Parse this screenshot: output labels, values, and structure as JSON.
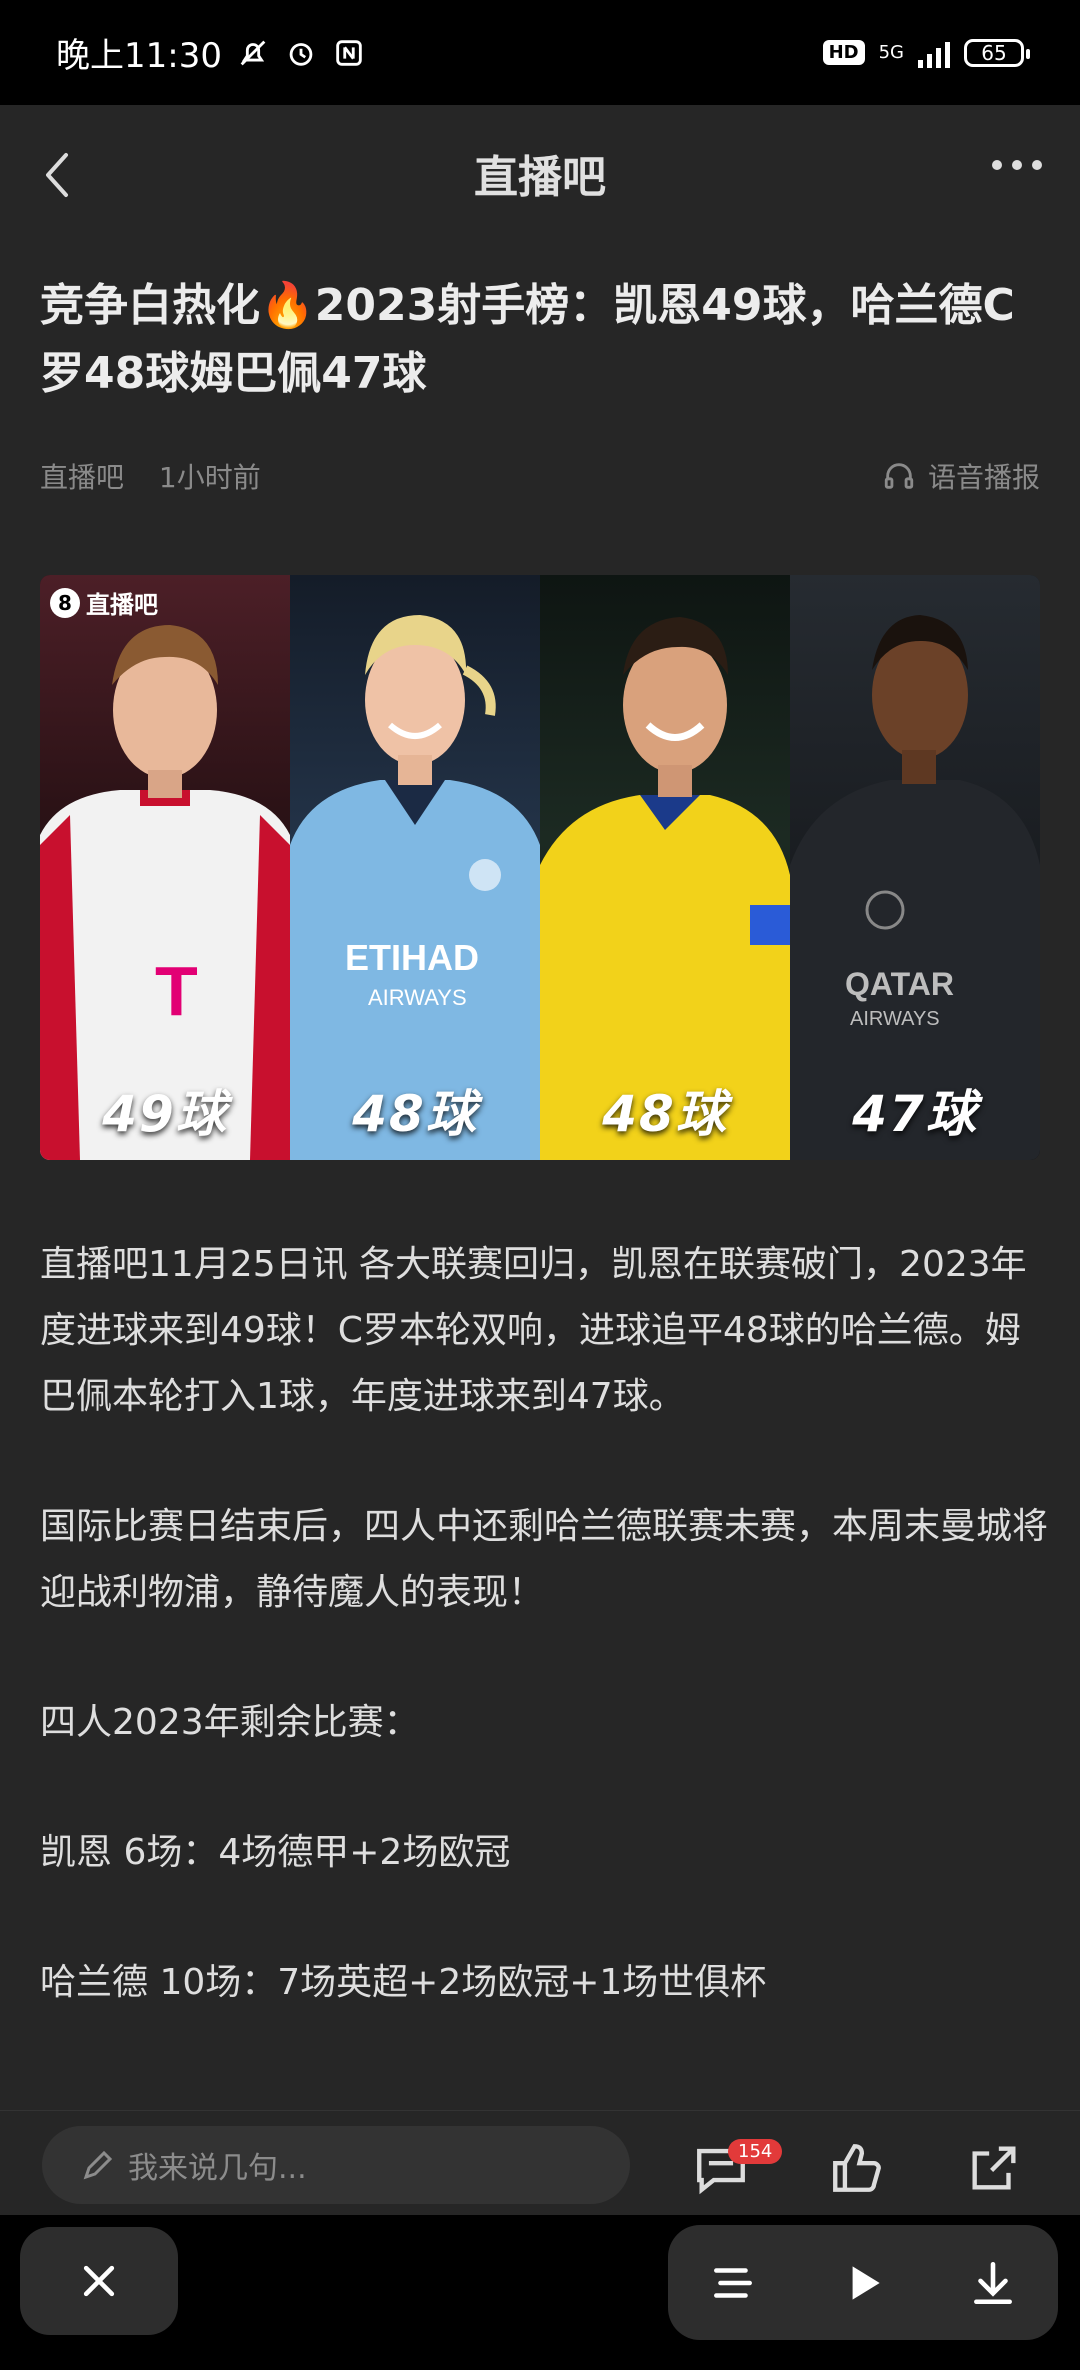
{
  "status_bar": {
    "time": "晚上11:30",
    "hd": "HD",
    "network": "5G",
    "battery": "65"
  },
  "nav": {
    "title": "直播吧"
  },
  "article": {
    "title": "竞争白热化🔥2023射手榜：凯恩49球，哈兰德C罗48球姆巴佩47球",
    "source": "直播吧",
    "time": "1小时前",
    "tts_label": "语音播报",
    "image": {
      "logo_text": "直播吧",
      "logo_num": "8",
      "players": [
        {
          "goals": "49球"
        },
        {
          "goals": "48球"
        },
        {
          "goals": "48球"
        },
        {
          "goals": "47球"
        }
      ]
    },
    "paragraphs": [
      "直播吧11月25日讯 各大联赛回归，凯恩在联赛破门，2023年度进球来到49球！C罗本轮双响，进球追平48球的哈兰德。姆巴佩本轮打入1球，年度进球来到47球。",
      "国际比赛日结束后，四人中还剩哈兰德联赛未赛，本周末曼城将迎战利物浦，静待魔人的表现！",
      "四人2023年剩余比赛：",
      "凯恩 6场：4场德甲+2场欧冠",
      "哈兰德 10场：7场英超+2场欧冠+1场世俱杯"
    ]
  },
  "comment_bar": {
    "placeholder": "我来说几句...",
    "comment_count": "154"
  },
  "colors": {
    "background": "#262626",
    "accent_badge": "#e23a3a"
  }
}
